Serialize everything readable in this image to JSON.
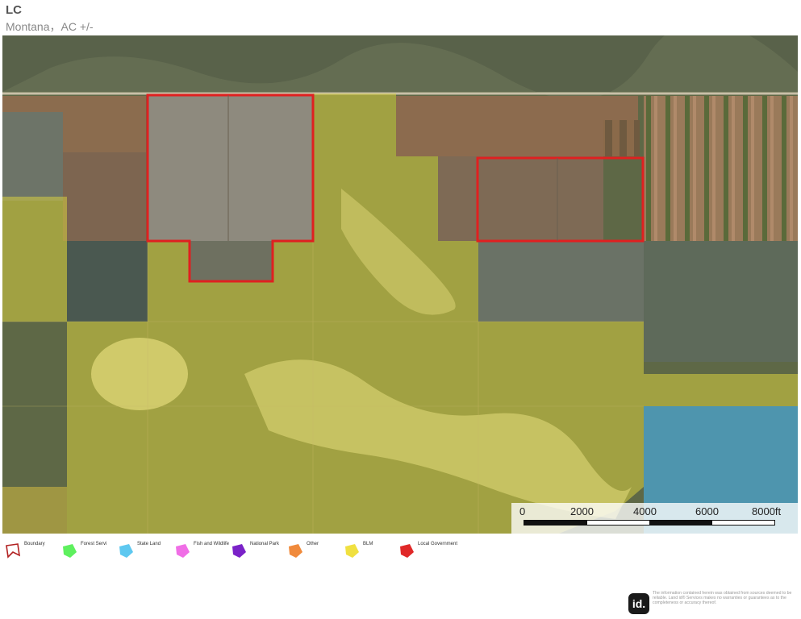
{
  "header": {
    "title": "LC",
    "subtitle": "Montana，AC +/-"
  },
  "scale": {
    "labels": [
      "0",
      "2000",
      "4000",
      "6000",
      "8000ft"
    ]
  },
  "legend": [
    {
      "label": "Boundary",
      "icon": "boundary-outline-icon",
      "color": "#b22222"
    },
    {
      "label": "Forest Servi",
      "icon": "forest-service-icon",
      "color": "#5ef05e"
    },
    {
      "label": "State Land",
      "icon": "state-land-icon",
      "color": "#5ec8f0"
    },
    {
      "label": "Fish and Wildlife",
      "icon": "fish-wildlife-icon",
      "color": "#f06ee6"
    },
    {
      "label": "National Park",
      "icon": "national-park-icon",
      "color": "#7a22c8"
    },
    {
      "label": "Other",
      "icon": "other-icon",
      "color": "#f08a3c"
    },
    {
      "label": "BLM",
      "icon": "blm-icon",
      "color": "#f0e040"
    },
    {
      "label": "Local Government",
      "icon": "local-government-icon",
      "color": "#e02828"
    }
  ],
  "footer": {
    "logo": "id.",
    "disclaimer": "The information contained herein was obtained from sources deemed to be reliable. Land id® Services makes no warranties or guarantees as to the completeness or accuracy thereof."
  }
}
